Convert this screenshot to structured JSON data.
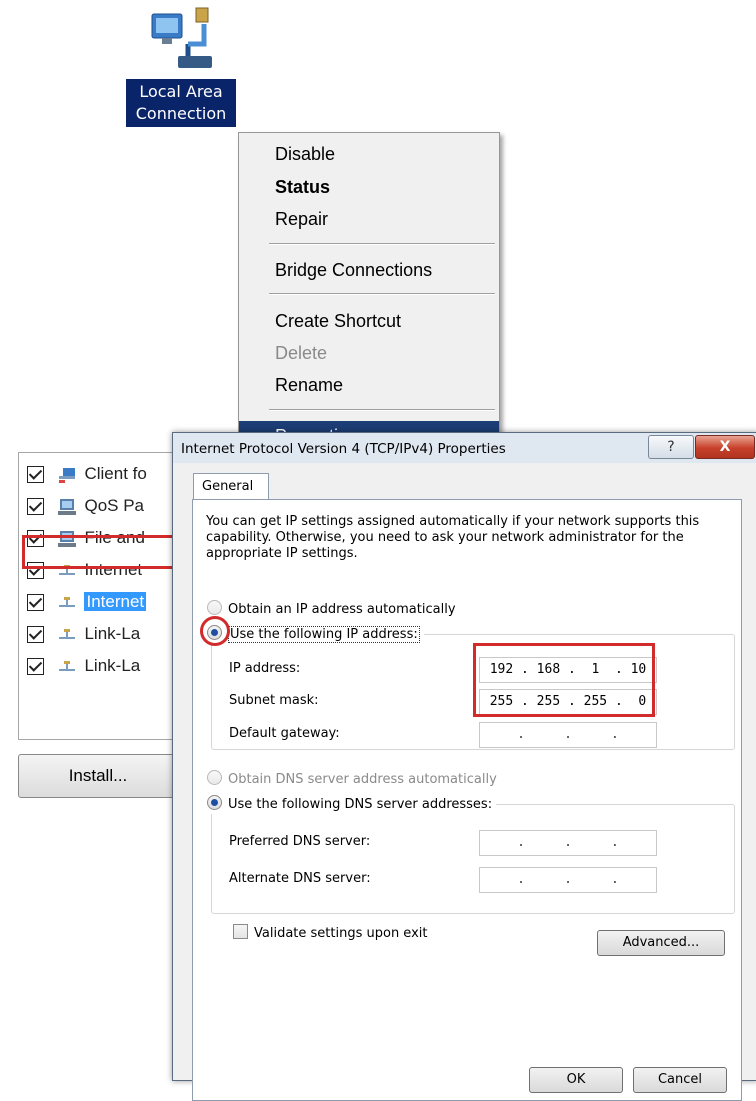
{
  "desktop_icon": {
    "label_line1": "Local Area",
    "label_line2": "Connection"
  },
  "context_menu": {
    "items": [
      {
        "label": "Disable"
      },
      {
        "label": "Status"
      },
      {
        "label": "Repair"
      },
      {
        "label": "Bridge Connections"
      },
      {
        "label": "Create Shortcut"
      },
      {
        "label": "Delete"
      },
      {
        "label": "Rename"
      },
      {
        "label": "Properties"
      }
    ]
  },
  "connection_items": [
    {
      "label": "Client fo"
    },
    {
      "label": "QoS Pa"
    },
    {
      "label": "File and"
    },
    {
      "label": "Internet"
    },
    {
      "label": "Internet"
    },
    {
      "label": "Link-La"
    },
    {
      "label": "Link-La"
    }
  ],
  "install_button": "Install...",
  "dialog": {
    "title": "Internet Protocol Version 4 (TCP/IPv4) Properties",
    "help": "?",
    "close": "X",
    "tab": "General",
    "description": "You can get IP settings assigned automatically if your network supports this capability. Otherwise, you need to ask your network administrator for the appropriate IP settings.",
    "ip_auto": "Obtain an IP address automatically",
    "ip_manual": "Use the following IP address:",
    "ip_address_label": "IP address:",
    "ip_address": "192 . 168 .  1  . 10",
    "subnet_label": "Subnet mask:",
    "subnet": "255 . 255 . 255 .  0",
    "gateway_label": "Default gateway:",
    "gateway": "  .     .     .  ",
    "dns_auto": "Obtain DNS server address automatically",
    "dns_manual": "Use the following DNS server addresses:",
    "preferred_label": "Preferred DNS server:",
    "preferred": "  .     .     .  ",
    "alternate_label": "Alternate DNS server:",
    "alternate": "  .     .     .  ",
    "validate": "Validate settings upon exit",
    "advanced": "Advanced...",
    "ok": "OK",
    "cancel": "Cancel"
  },
  "colors": {
    "selection": "#0a246a",
    "menu_highlight": "#1c3d75",
    "annotation_red": "#d22b2b"
  }
}
